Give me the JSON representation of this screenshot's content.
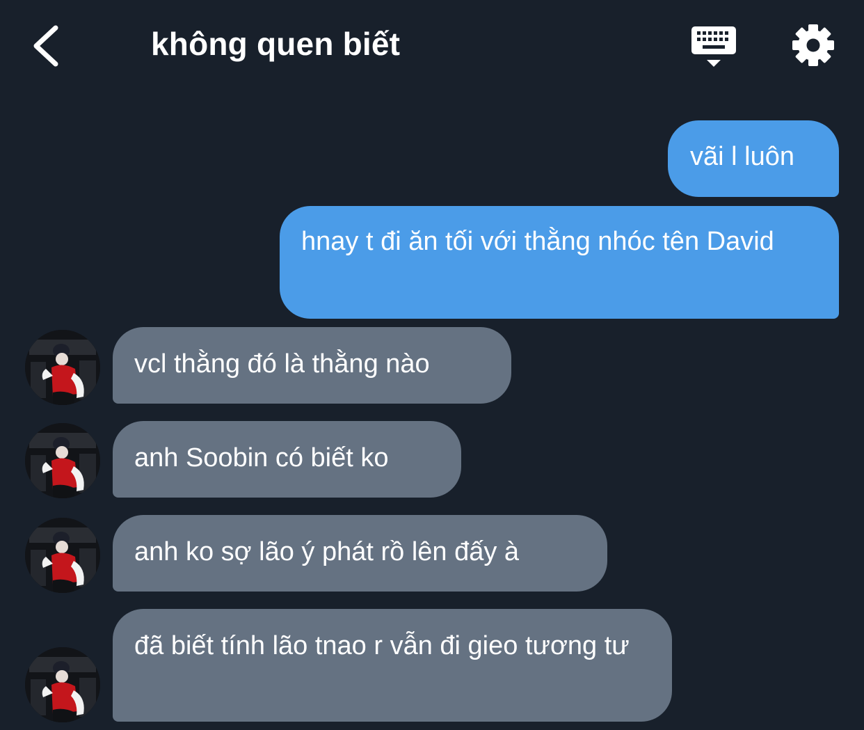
{
  "header": {
    "title": "không quen biết",
    "back_icon": "chevron-left-icon",
    "keyboard_icon": "keyboard-hide-icon",
    "settings_icon": "gear-icon"
  },
  "colors": {
    "background": "#18202b",
    "outgoing_bubble": "#4b9ce8",
    "incoming_bubble": "#657282",
    "text": "#ffffff"
  },
  "messages": [
    {
      "from": "me",
      "text": "vãi l luôn"
    },
    {
      "from": "me",
      "text": "hnay t đi ăn tối với thằng nhóc tên David"
    },
    {
      "from": "them",
      "text": "vcl thằng đó là thằng nào"
    },
    {
      "from": "them",
      "text": "anh Soobin có biết ko"
    },
    {
      "from": "them",
      "text": "anh ko sợ lão ý phát rồ lên đấy à"
    },
    {
      "from": "them",
      "text": "đã biết tính lão tnao r vẫn đi gieo tương tư"
    }
  ]
}
